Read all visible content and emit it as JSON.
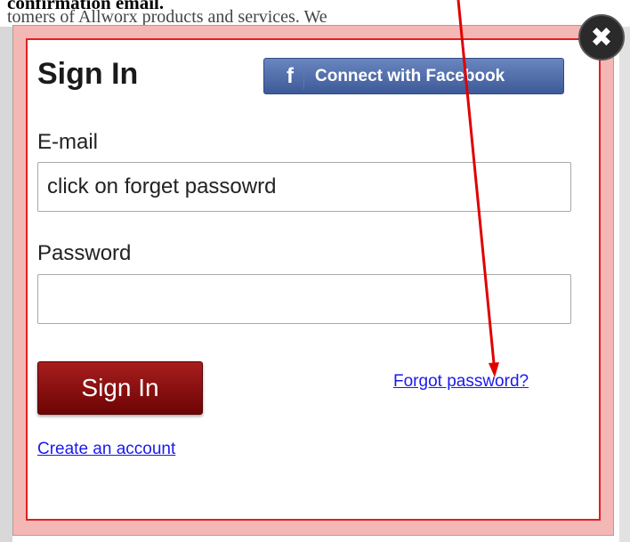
{
  "background": {
    "line1": "confirmation email.",
    "line2": "tomers of Allworx products and services. We"
  },
  "modal": {
    "title": "Sign In",
    "facebook_button": {
      "icon": "f",
      "label": "Connect with Facebook"
    },
    "email": {
      "label": "E-mail",
      "value": "click on forget passowrd"
    },
    "password": {
      "label": "Password",
      "value": ""
    },
    "signin_button": "Sign In",
    "forgot_link": "Forgot password?",
    "create_account_link": "Create an account",
    "close_icon": "✖"
  },
  "colors": {
    "accent_red": "#e02020",
    "signin_button": "#8b0b0b",
    "facebook_blue": "#4a67a8",
    "link_blue": "#1a1aee",
    "overlay_pink": "#f3b8b5"
  },
  "icons": [
    "facebook-icon",
    "close-icon"
  ]
}
